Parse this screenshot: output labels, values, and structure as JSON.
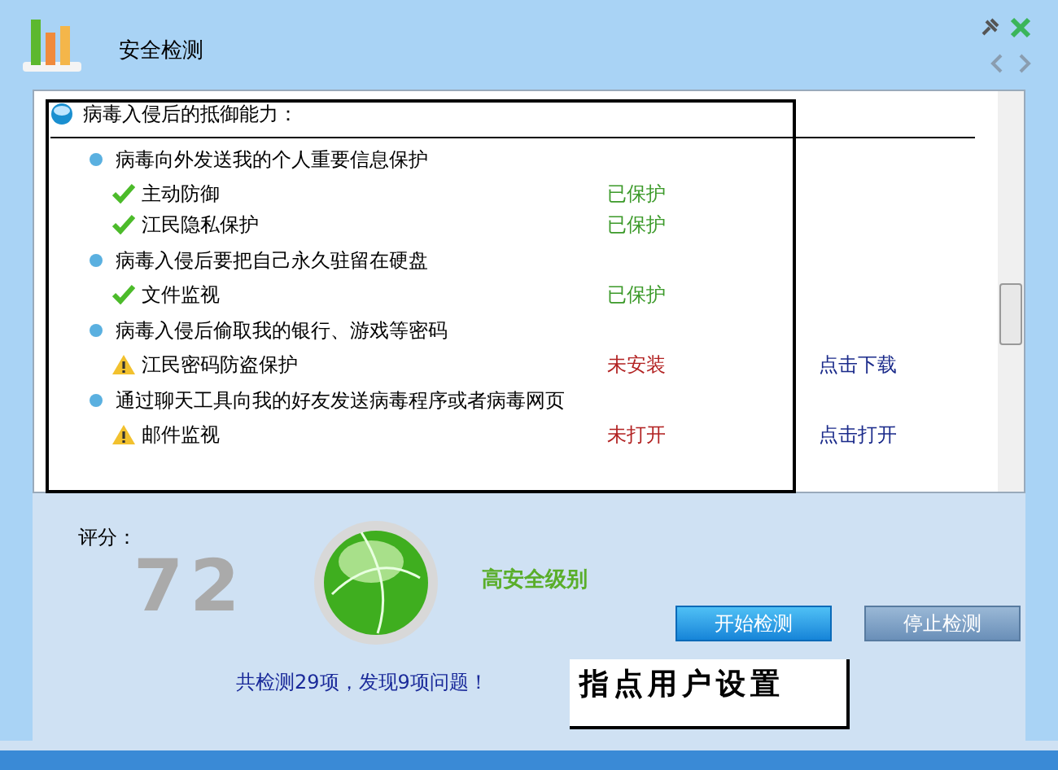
{
  "window": {
    "title": "安全检测"
  },
  "panel": {
    "heading": "病毒入侵后的抵御能力：",
    "groups": [
      {
        "title": "病毒向外发送我的个人重要信息保护",
        "items": [
          {
            "label": "主动防御",
            "kind": "ok",
            "status": "已保护"
          },
          {
            "label": "江民隐私保护",
            "kind": "ok",
            "status": "已保护"
          }
        ]
      },
      {
        "title": "病毒入侵后要把自己永久驻留在硬盘",
        "items": [
          {
            "label": "文件监视",
            "kind": "ok",
            "status": "已保护"
          }
        ]
      },
      {
        "title": "病毒入侵后偷取我的银行、游戏等密码",
        "items": [
          {
            "label": "江民密码防盗保护",
            "kind": "warn",
            "status": "未安装",
            "action": "点击下载"
          }
        ]
      },
      {
        "title": "通过聊天工具向我的好友发送病毒程序或者病毒网页",
        "items": [
          {
            "label": "邮件监视",
            "kind": "warn",
            "status": "未打开",
            "action": "点击打开"
          }
        ]
      }
    ]
  },
  "score": {
    "label": "评分：",
    "value": "72",
    "rating": "高安全级别"
  },
  "buttons": [
    {
      "label": "开始检测",
      "kind": "primary"
    },
    {
      "label": "停止检测",
      "kind": "secondary"
    }
  ],
  "summary": "共检测29项，发现9项问题！",
  "annotation": "指点用户设置"
}
